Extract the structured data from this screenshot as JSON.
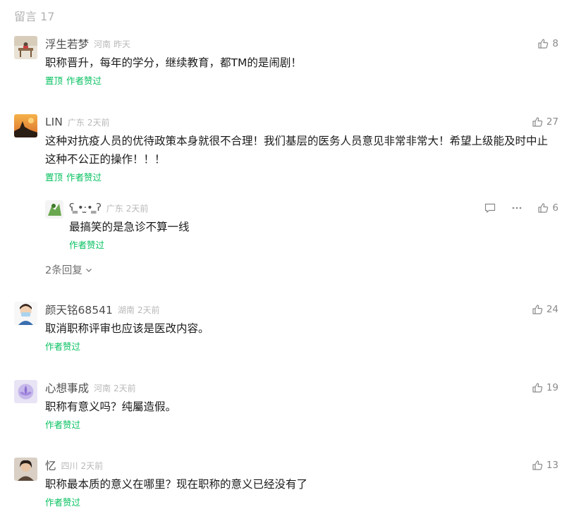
{
  "header": {
    "title": "留言 17"
  },
  "comments": [
    {
      "name": "浮生若梦",
      "location": "河南",
      "time": "昨天",
      "likes": "8",
      "text": "职称晋升，每年的学分，继续教育，都TM的是闹剧！",
      "pin_tag": "置顶",
      "author_tag": "作者赞过",
      "avatar_icon": "desk-avatar"
    },
    {
      "name": "LIN",
      "location": "广东",
      "time": "2天前",
      "likes": "27",
      "text": "这种对抗疫人员的优待政策本身就很不合理！我们基层的医务人员意见非常非常大！希望上级能及时中止这种不公正的操作！！！",
      "pin_tag": "置顶",
      "author_tag": "作者赞过",
      "avatar_icon": "sunset-silhouette-avatar",
      "reply": {
        "name": "ʕ ̳•·̫• ̳ʔ",
        "location": "广东",
        "time": "2天前",
        "likes": "6",
        "text": "最搞笑的是急诊不算一线",
        "author_tag": "作者赞过",
        "avatar_icon": "green-cartoon-avatar"
      },
      "more_replies": "2条回复"
    },
    {
      "name": "颜天铭68541",
      "location": "湖南",
      "time": "2天前",
      "likes": "24",
      "text": "取消职称评审也应该是医改内容。",
      "author_tag": "作者赞过",
      "avatar_icon": "masked-person-avatar"
    },
    {
      "name": "心想事成",
      "location": "河南",
      "time": "2天前",
      "likes": "19",
      "text": "职称有意义吗？纯屬造假。",
      "author_tag": "作者赞过",
      "avatar_icon": "lotus-avatar"
    },
    {
      "name": "忆",
      "location": "四川",
      "time": "2天前",
      "likes": "13",
      "text": "职称最本质的意义在哪里？现在职称的意义已经没有了",
      "author_tag": "作者赞过",
      "avatar_icon": "portrait-avatar"
    }
  ],
  "colors": {
    "accent_green": "#07c160",
    "muted": "#b8b8b8"
  }
}
